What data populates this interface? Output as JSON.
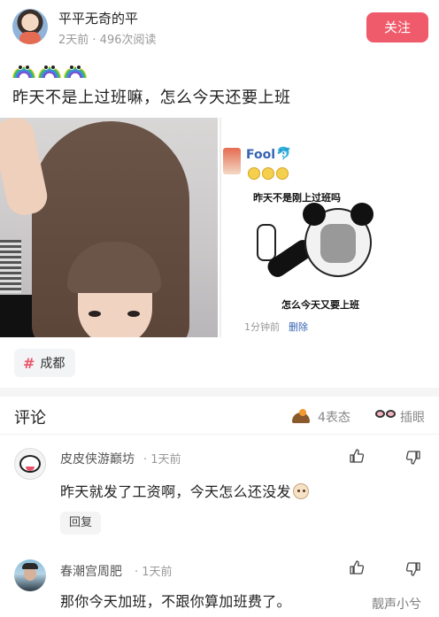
{
  "post": {
    "author": "平平无奇的平",
    "meta": "2天前 · 496次阅读",
    "follow_label": "关注",
    "emoji_icons": [
      "rainbow-face-icon",
      "rainbow-face-icon",
      "rainbow-face-icon"
    ],
    "text": "昨天不是上过班嘛，怎么今天还要上班",
    "meme": {
      "name": "Fool",
      "top_caption": "昨天不是刚上过班吗",
      "bottom_caption": "怎么今天又要上班",
      "time": "1分钟前",
      "delete_label": "删除"
    },
    "tag": "成都"
  },
  "comments_section": {
    "title": "评论",
    "reactions_label": "4表态",
    "insert_label": "插眼"
  },
  "comments": [
    {
      "user": "皮皮侠游巅坊",
      "time": "· 1天前",
      "text": "昨天就发了工资啊，今天怎么还没发",
      "reply_label": "回复"
    },
    {
      "user": "春潮宫周肥",
      "time": "· 1天前",
      "text": "那你今天加班，不跟你算加班费了。"
    }
  ],
  "watermark": "靓声小兮",
  "colors": {
    "accent": "#f05b6b",
    "link": "#3563b3"
  }
}
